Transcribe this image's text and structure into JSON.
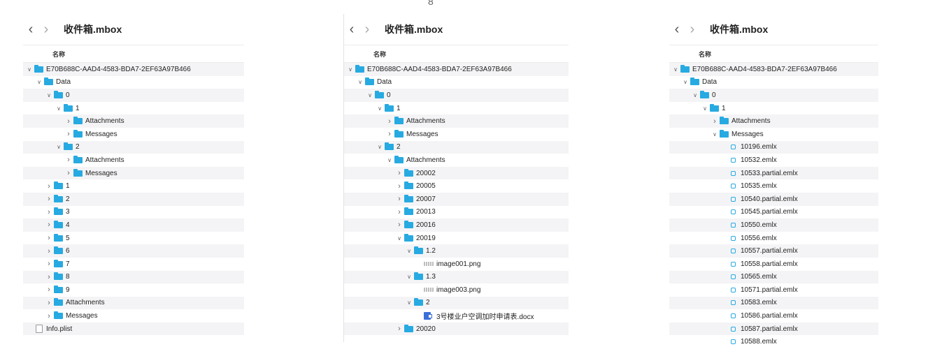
{
  "top_fragment": "8",
  "panels": [
    {
      "title": "收件箱.mbox",
      "column_header": "名称",
      "rows": [
        {
          "label": "E70B688C-AAD4-4583-BDA7-2EF63A97B466",
          "depth": 0,
          "kind": "folder",
          "state": "open"
        },
        {
          "label": "Data",
          "depth": 1,
          "kind": "folder",
          "state": "open"
        },
        {
          "label": "0",
          "depth": 2,
          "kind": "folder",
          "state": "open"
        },
        {
          "label": "1",
          "depth": 3,
          "kind": "folder",
          "state": "open"
        },
        {
          "label": "Attachments",
          "depth": 4,
          "kind": "folder",
          "state": "closed"
        },
        {
          "label": "Messages",
          "depth": 4,
          "kind": "folder",
          "state": "closed"
        },
        {
          "label": "2",
          "depth": 3,
          "kind": "folder",
          "state": "open"
        },
        {
          "label": "Attachments",
          "depth": 4,
          "kind": "folder",
          "state": "closed"
        },
        {
          "label": "Messages",
          "depth": 4,
          "kind": "folder",
          "state": "closed"
        },
        {
          "label": "1",
          "depth": 2,
          "kind": "folder",
          "state": "closed"
        },
        {
          "label": "2",
          "depth": 2,
          "kind": "folder",
          "state": "closed"
        },
        {
          "label": "3",
          "depth": 2,
          "kind": "folder",
          "state": "closed"
        },
        {
          "label": "4",
          "depth": 2,
          "kind": "folder",
          "state": "closed"
        },
        {
          "label": "5",
          "depth": 2,
          "kind": "folder",
          "state": "closed"
        },
        {
          "label": "6",
          "depth": 2,
          "kind": "folder",
          "state": "closed"
        },
        {
          "label": "7",
          "depth": 2,
          "kind": "folder",
          "state": "closed"
        },
        {
          "label": "8",
          "depth": 2,
          "kind": "folder",
          "state": "closed"
        },
        {
          "label": "9",
          "depth": 2,
          "kind": "folder",
          "state": "closed"
        },
        {
          "label": "Attachments",
          "depth": 2,
          "kind": "folder",
          "state": "closed"
        },
        {
          "label": "Messages",
          "depth": 2,
          "kind": "folder",
          "state": "closed"
        },
        {
          "label": "Info.plist",
          "depth": 0,
          "kind": "doc",
          "state": "none"
        }
      ]
    },
    {
      "title": "收件箱.mbox",
      "column_header": "名称",
      "rows": [
        {
          "label": "E70B688C-AAD4-4583-BDA7-2EF63A97B466",
          "depth": 0,
          "kind": "folder",
          "state": "open"
        },
        {
          "label": "Data",
          "depth": 1,
          "kind": "folder",
          "state": "open"
        },
        {
          "label": "0",
          "depth": 2,
          "kind": "folder",
          "state": "open"
        },
        {
          "label": "1",
          "depth": 3,
          "kind": "folder",
          "state": "open"
        },
        {
          "label": "Attachments",
          "depth": 4,
          "kind": "folder",
          "state": "closed"
        },
        {
          "label": "Messages",
          "depth": 4,
          "kind": "folder",
          "state": "closed"
        },
        {
          "label": "2",
          "depth": 3,
          "kind": "folder",
          "state": "open"
        },
        {
          "label": "Attachments",
          "depth": 4,
          "kind": "folder",
          "state": "open"
        },
        {
          "label": "20002",
          "depth": 5,
          "kind": "folder",
          "state": "closed"
        },
        {
          "label": "20005",
          "depth": 5,
          "kind": "folder",
          "state": "closed"
        },
        {
          "label": "20007",
          "depth": 5,
          "kind": "folder",
          "state": "closed"
        },
        {
          "label": "20013",
          "depth": 5,
          "kind": "folder",
          "state": "closed"
        },
        {
          "label": "20016",
          "depth": 5,
          "kind": "folder",
          "state": "closed"
        },
        {
          "label": "20019",
          "depth": 5,
          "kind": "folder",
          "state": "open"
        },
        {
          "label": "1.2",
          "depth": 6,
          "kind": "folder",
          "state": "open"
        },
        {
          "label": "image001.png",
          "depth": 7,
          "kind": "image",
          "state": "none"
        },
        {
          "label": "1.3",
          "depth": 6,
          "kind": "folder",
          "state": "open"
        },
        {
          "label": "image003.png",
          "depth": 7,
          "kind": "image",
          "state": "none"
        },
        {
          "label": "2",
          "depth": 6,
          "kind": "folder",
          "state": "open"
        },
        {
          "label": "3号楼业户空调加时申请表.docx",
          "depth": 7,
          "kind": "word",
          "state": "none"
        },
        {
          "label": "20020",
          "depth": 5,
          "kind": "folder",
          "state": "closed"
        }
      ]
    },
    {
      "title": "收件箱.mbox",
      "column_header": "名称",
      "rows": [
        {
          "label": "E70B688C-AAD4-4583-BDA7-2EF63A97B466",
          "depth": 0,
          "kind": "folder",
          "state": "open"
        },
        {
          "label": "Data",
          "depth": 1,
          "kind": "folder",
          "state": "open"
        },
        {
          "label": "0",
          "depth": 2,
          "kind": "folder",
          "state": "open"
        },
        {
          "label": "1",
          "depth": 3,
          "kind": "folder",
          "state": "open"
        },
        {
          "label": "Attachments",
          "depth": 4,
          "kind": "folder",
          "state": "closed"
        },
        {
          "label": "Messages",
          "depth": 4,
          "kind": "folder",
          "state": "open"
        },
        {
          "label": "10196.emlx",
          "depth": 5,
          "kind": "emlx",
          "state": "none"
        },
        {
          "label": "10532.emlx",
          "depth": 5,
          "kind": "emlx",
          "state": "none"
        },
        {
          "label": "10533.partial.emlx",
          "depth": 5,
          "kind": "emlx",
          "state": "none"
        },
        {
          "label": "10535.emlx",
          "depth": 5,
          "kind": "emlx",
          "state": "none"
        },
        {
          "label": "10540.partial.emlx",
          "depth": 5,
          "kind": "emlx",
          "state": "none"
        },
        {
          "label": "10545.partial.emlx",
          "depth": 5,
          "kind": "emlx",
          "state": "none"
        },
        {
          "label": "10550.emlx",
          "depth": 5,
          "kind": "emlx",
          "state": "none"
        },
        {
          "label": "10556.emlx",
          "depth": 5,
          "kind": "emlx",
          "state": "none"
        },
        {
          "label": "10557.partial.emlx",
          "depth": 5,
          "kind": "emlx",
          "state": "none"
        },
        {
          "label": "10558.partial.emlx",
          "depth": 5,
          "kind": "emlx",
          "state": "none"
        },
        {
          "label": "10565.emlx",
          "depth": 5,
          "kind": "emlx",
          "state": "none"
        },
        {
          "label": "10571.partial.emlx",
          "depth": 5,
          "kind": "emlx",
          "state": "none"
        },
        {
          "label": "10583.emlx",
          "depth": 5,
          "kind": "emlx",
          "state": "none"
        },
        {
          "label": "10586.partial.emlx",
          "depth": 5,
          "kind": "emlx",
          "state": "none"
        },
        {
          "label": "10587.partial.emlx",
          "depth": 5,
          "kind": "emlx",
          "state": "none"
        },
        {
          "label": "10588.emlx",
          "depth": 5,
          "kind": "emlx",
          "state": "none"
        }
      ]
    }
  ]
}
